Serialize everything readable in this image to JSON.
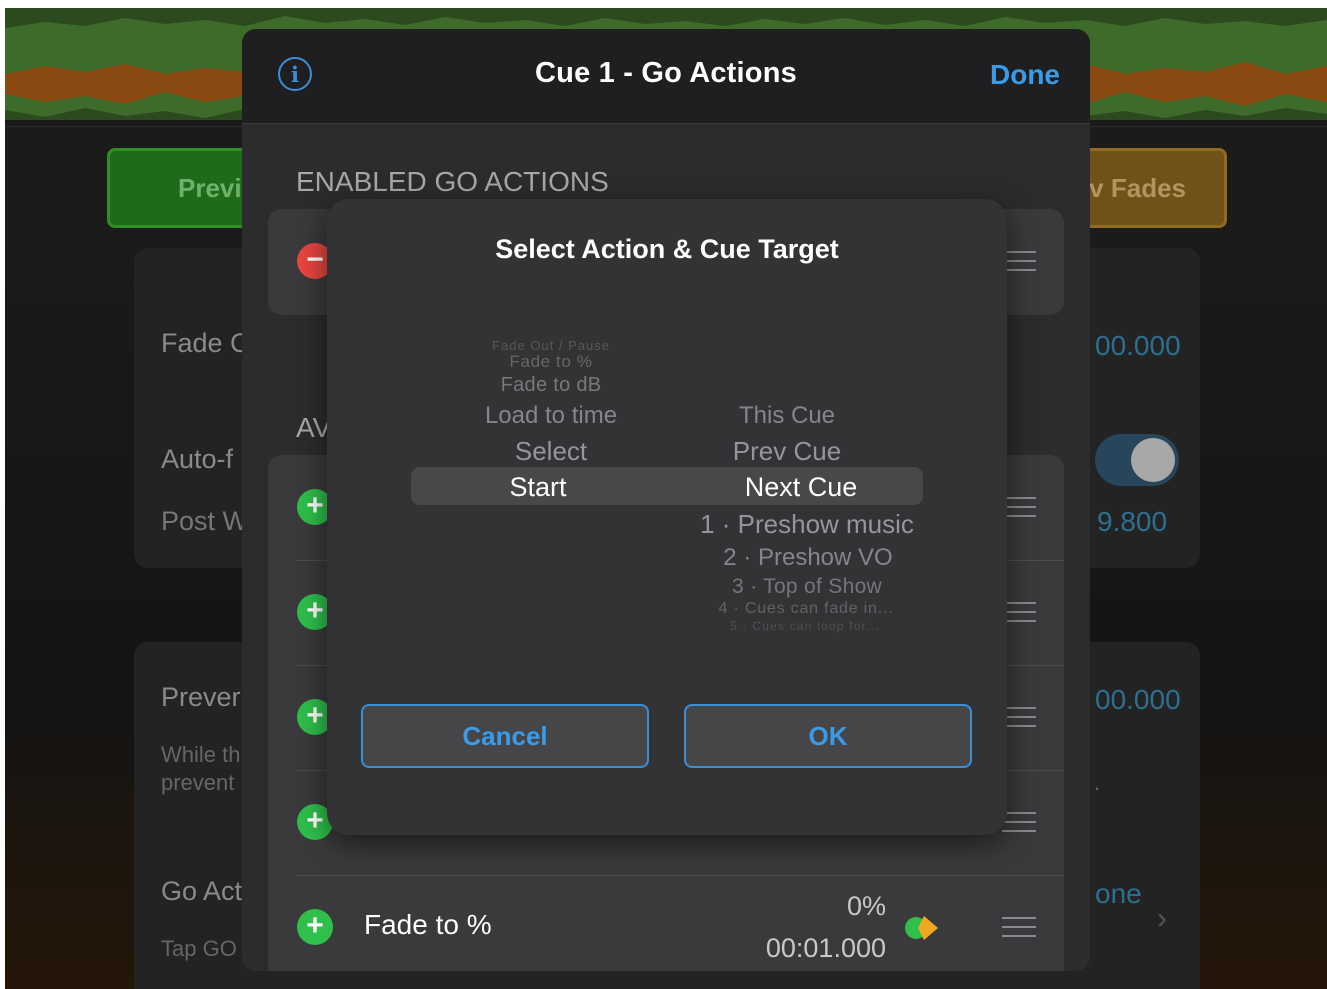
{
  "background": {
    "toolbar": {
      "left_button": "Previ",
      "right_button": "v Fades"
    },
    "rows": [
      {
        "label": "Fade C",
        "value": "00.000"
      },
      {
        "label": "Auto-f",
        "toggle_on": true
      },
      {
        "label": "Post W",
        "value": "9.800"
      },
      {
        "label": "Prever",
        "sub1": "While th",
        "sub2": "prevent",
        "value": "00.000",
        "trailing": "."
      },
      {
        "label": "Go Act",
        "sub1": "Tap GO",
        "value": "one"
      }
    ]
  },
  "sheet": {
    "title": "Cue 1 - Go Actions",
    "done_label": "Done",
    "enabled_header": "ENABLED GO ACTIONS",
    "available_header": "AV",
    "available_rows": [
      {
        "label": "",
        "value1": "",
        "value2": ""
      },
      {
        "label": "",
        "value1": "",
        "value2": ""
      },
      {
        "label": "",
        "value1": "",
        "value2": ""
      },
      {
        "label": "",
        "value1": "",
        "value2": ""
      },
      {
        "label": "Fade to %",
        "value1": "0%",
        "value2": "00:01.000"
      }
    ]
  },
  "dialog": {
    "title": "Select Action & Cue Target",
    "actions": {
      "items": [
        "Fade Out / Pause",
        "Fade to %",
        "Fade to dB",
        "Load to time",
        "Select",
        "Start"
      ],
      "selected": "Start"
    },
    "targets": {
      "items": [
        "This Cue",
        "Prev Cue",
        "Next Cue",
        "1 · Preshow music",
        "2 · Preshow VO",
        "3 · Top of Show",
        "4 · Cues can fade in...",
        "5 · Cues can loop for..."
      ],
      "selected": "Next Cue"
    },
    "cancel_label": "Cancel",
    "ok_label": "OK"
  },
  "colors": {
    "accent": "#3a9be8",
    "add_green": "#2fbf4a",
    "remove_red": "#e8463f"
  }
}
